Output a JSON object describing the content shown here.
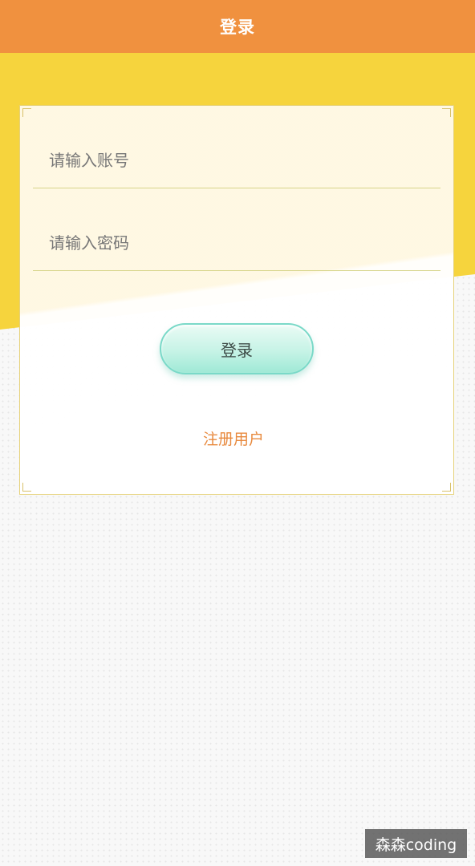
{
  "header": {
    "title": "登录"
  },
  "form": {
    "account_placeholder": "请输入账号",
    "password_placeholder": "请输入密码",
    "login_button_label": "登录",
    "register_link": "注册用户"
  },
  "watermark": {
    "text": "森森coding"
  },
  "colors": {
    "header_bg": "#f0913f",
    "yellow_band": "#f6d43d",
    "button_border": "#7ad9c8",
    "register_link": "#e88a3f"
  }
}
